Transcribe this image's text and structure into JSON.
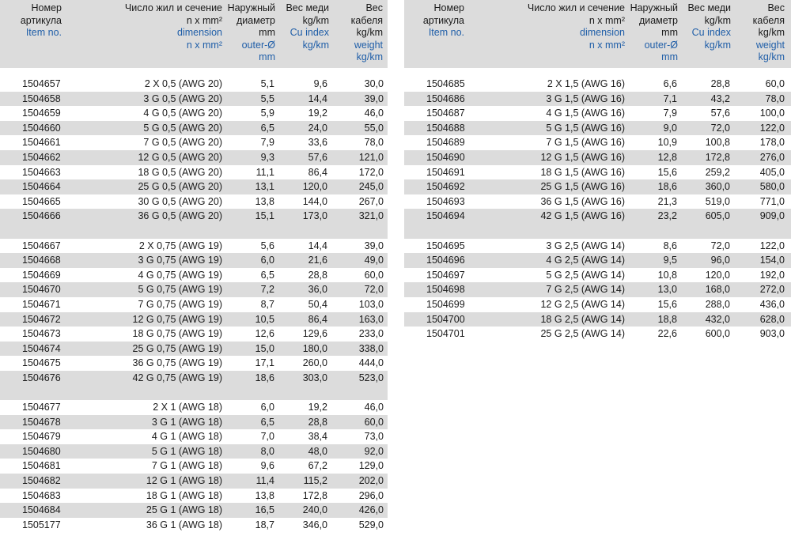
{
  "headers": {
    "col1": {
      "ru": [
        "Номер",
        "артикула"
      ],
      "en": [
        "Item no."
      ]
    },
    "col2": {
      "ru": [
        "Число жил и сечение",
        "n x mm²"
      ],
      "en": [
        "dimension",
        "n x mm²"
      ]
    },
    "col3": {
      "ru": [
        "Наружный",
        "диаметр",
        "mm"
      ],
      "en": [
        "outer-Ø",
        "mm"
      ]
    },
    "col4": {
      "ru": [
        "Вес меди",
        "kg/km"
      ],
      "en": [
        "Cu index",
        "kg/km"
      ]
    },
    "col5": {
      "ru": [
        "Вес",
        "кабеля",
        "kg/km"
      ],
      "en": [
        "weight",
        "kg/km"
      ]
    }
  },
  "left_groups": [
    [
      [
        "1504657",
        "2 X 0,5 (AWG 20)",
        "5,1",
        "9,6",
        "30,0"
      ],
      [
        "1504658",
        "3 G 0,5 (AWG 20)",
        "5,5",
        "14,4",
        "39,0"
      ],
      [
        "1504659",
        "4 G 0,5 (AWG 20)",
        "5,9",
        "19,2",
        "46,0"
      ],
      [
        "1504660",
        "5 G 0,5 (AWG 20)",
        "6,5",
        "24,0",
        "55,0"
      ],
      [
        "1504661",
        "7 G 0,5 (AWG 20)",
        "7,9",
        "33,6",
        "78,0"
      ],
      [
        "1504662",
        "12 G 0,5 (AWG 20)",
        "9,3",
        "57,6",
        "121,0"
      ],
      [
        "1504663",
        "18 G 0,5 (AWG 20)",
        "11,1",
        "86,4",
        "172,0"
      ],
      [
        "1504664",
        "25 G 0,5 (AWG 20)",
        "13,1",
        "120,0",
        "245,0"
      ],
      [
        "1504665",
        "30 G 0,5 (AWG 20)",
        "13,8",
        "144,0",
        "267,0"
      ],
      [
        "1504666",
        "36 G 0,5 (AWG 20)",
        "15,1",
        "173,0",
        "321,0"
      ]
    ],
    [
      [
        "1504667",
        "2 X 0,75 (AWG 19)",
        "5,6",
        "14,4",
        "39,0"
      ],
      [
        "1504668",
        "3 G 0,75 (AWG 19)",
        "6,0",
        "21,6",
        "49,0"
      ],
      [
        "1504669",
        "4 G 0,75 (AWG 19)",
        "6,5",
        "28,8",
        "60,0"
      ],
      [
        "1504670",
        "5 G 0,75 (AWG 19)",
        "7,2",
        "36,0",
        "72,0"
      ],
      [
        "1504671",
        "7 G 0,75 (AWG 19)",
        "8,7",
        "50,4",
        "103,0"
      ],
      [
        "1504672",
        "12 G 0,75 (AWG 19)",
        "10,5",
        "86,4",
        "163,0"
      ],
      [
        "1504673",
        "18 G 0,75 (AWG 19)",
        "12,6",
        "129,6",
        "233,0"
      ],
      [
        "1504674",
        "25 G 0,75 (AWG 19)",
        "15,0",
        "180,0",
        "338,0"
      ],
      [
        "1504675",
        "36 G 0,75 (AWG 19)",
        "17,1",
        "260,0",
        "444,0"
      ],
      [
        "1504676",
        "42 G 0,75 (AWG 19)",
        "18,6",
        "303,0",
        "523,0"
      ]
    ],
    [
      [
        "1504677",
        "2 X 1 (AWG 18)",
        "6,0",
        "19,2",
        "46,0"
      ],
      [
        "1504678",
        "3 G 1 (AWG 18)",
        "6,5",
        "28,8",
        "60,0"
      ],
      [
        "1504679",
        "4 G 1 (AWG 18)",
        "7,0",
        "38,4",
        "73,0"
      ],
      [
        "1504680",
        "5 G 1 (AWG 18)",
        "8,0",
        "48,0",
        "92,0"
      ],
      [
        "1504681",
        "7 G 1 (AWG 18)",
        "9,6",
        "67,2",
        "129,0"
      ],
      [
        "1504682",
        "12 G 1 (AWG 18)",
        "11,4",
        "115,2",
        "202,0"
      ],
      [
        "1504683",
        "18 G 1 (AWG 18)",
        "13,8",
        "172,8",
        "296,0"
      ],
      [
        "1504684",
        "25 G 1 (AWG 18)",
        "16,5",
        "240,0",
        "426,0"
      ],
      [
        "1505177",
        "36 G 1 (AWG 18)",
        "18,7",
        "346,0",
        "529,0"
      ]
    ]
  ],
  "right_groups": [
    [
      [
        "1504685",
        "2 X 1,5 (AWG 16)",
        "6,6",
        "28,8",
        "60,0"
      ],
      [
        "1504686",
        "3 G 1,5 (AWG 16)",
        "7,1",
        "43,2",
        "78,0"
      ],
      [
        "1504687",
        "4 G 1,5 (AWG 16)",
        "7,9",
        "57,6",
        "100,0"
      ],
      [
        "1504688",
        "5 G 1,5 (AWG 16)",
        "9,0",
        "72,0",
        "122,0"
      ],
      [
        "1504689",
        "7 G 1,5 (AWG 16)",
        "10,9",
        "100,8",
        "178,0"
      ],
      [
        "1504690",
        "12 G 1,5 (AWG 16)",
        "12,8",
        "172,8",
        "276,0"
      ],
      [
        "1504691",
        "18 G 1,5 (AWG 16)",
        "15,6",
        "259,2",
        "405,0"
      ],
      [
        "1504692",
        "25 G 1,5 (AWG 16)",
        "18,6",
        "360,0",
        "580,0"
      ],
      [
        "1504693",
        "36 G 1,5 (AWG 16)",
        "21,3",
        "519,0",
        "771,0"
      ],
      [
        "1504694",
        "42 G 1,5 (AWG 16)",
        "23,2",
        "605,0",
        "909,0"
      ]
    ],
    [
      [
        "1504695",
        "3 G 2,5 (AWG 14)",
        "8,6",
        "72,0",
        "122,0"
      ],
      [
        "1504696",
        "4 G 2,5 (AWG 14)",
        "9,5",
        "96,0",
        "154,0"
      ],
      [
        "1504697",
        "5 G 2,5 (AWG 14)",
        "10,8",
        "120,0",
        "192,0"
      ],
      [
        "1504698",
        "7 G 2,5 (AWG 14)",
        "13,0",
        "168,0",
        "272,0"
      ],
      [
        "1504699",
        "12 G 2,5 (AWG 14)",
        "15,6",
        "288,0",
        "436,0"
      ],
      [
        "1504700",
        "18 G 2,5 (AWG 14)",
        "18,8",
        "432,0",
        "628,0"
      ],
      [
        "1504701",
        "25 G 2,5 (AWG 14)",
        "22,6",
        "600,0",
        "903,0"
      ]
    ]
  ]
}
